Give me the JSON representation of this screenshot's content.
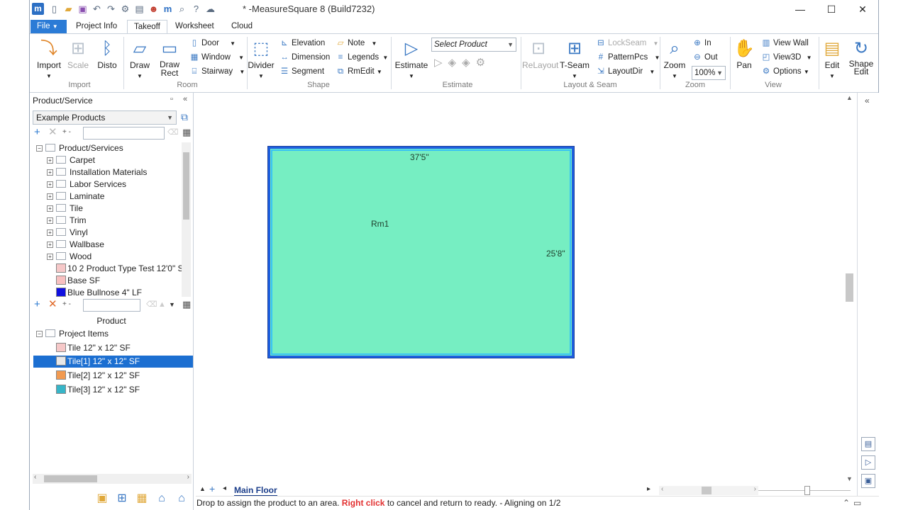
{
  "window": {
    "title": "* -MeasureSquare 8 (Build7232)",
    "logo": "m",
    "controls": [
      "—",
      "☐",
      "✕"
    ]
  },
  "quick_access": [
    "new-doc-icon",
    "open-folder-icon",
    "save-icon",
    "undo-icon",
    "redo-icon",
    "settings-icon",
    "template-icon",
    "person-icon",
    "m-logo-icon",
    "print-preview-icon",
    "help-icon",
    "cloud-icon"
  ],
  "tabs": {
    "file": "File",
    "items": [
      "Project Info",
      "Takeoff",
      "Worksheet",
      "Cloud"
    ],
    "active": "Takeoff"
  },
  "ribbon": {
    "import": {
      "label": "Import",
      "group": "Import"
    },
    "scale": {
      "label": "Scale"
    },
    "disto": {
      "label": "Disto"
    },
    "draw": {
      "label": "Draw"
    },
    "draw_rect": {
      "label": "Draw\nRect"
    },
    "door": "Door",
    "window": "Window",
    "stairway": "Stairway",
    "room_group": "Room",
    "divider": "Divider",
    "elevation": "Elevation",
    "dimension": "Dimension",
    "segment": "Segment",
    "note": "Note",
    "legends": "Legends",
    "rmedit": "RmEdit",
    "shape_group": "Shape",
    "estimate": "Estimate",
    "select_product": "Select Product",
    "estimate_group": "Estimate",
    "relayout": "ReLayout",
    "tseam": "T-Seam",
    "lockseam": "LockSeam",
    "patternpcs": "PatternPcs",
    "layoutdir": "LayoutDir",
    "layout_group": "Layout & Seam",
    "zoom": "Zoom",
    "zoom_in": "In",
    "zoom_out": "Out",
    "zoom_level": "100%",
    "zoom_group": "Zoom",
    "pan": "Pan",
    "view_wall": "View Wall",
    "view3d": "View3D",
    "options": "Options",
    "view_group": "View",
    "edit": "Edit",
    "shape_edit": "Shape\nEdit"
  },
  "left_panel": {
    "title": "Product/Service",
    "catalog": "Example Products",
    "tree_root": "Product/Services",
    "categories": [
      "Carpet",
      "Installation Materials",
      "Labor Services",
      "Laminate",
      "Tile",
      "Trim",
      "Vinyl",
      "Wallbase",
      "Wood"
    ],
    "products": [
      {
        "label": "10 2 Product Type Test 12'0\" SY",
        "color": "#f6c8c8"
      },
      {
        "label": "Base  SF",
        "color": "#f8c0c0"
      },
      {
        "label": "Blue Bullnose 4\" LF",
        "color": "#1010e0"
      }
    ],
    "column_header": "Product",
    "project_root": "Project Items",
    "project_items": [
      {
        "label": "Tile 12\" x 12\" SF",
        "color": "#f6c8c8",
        "selected": false
      },
      {
        "label": "Tile[1] 12\" x 12\" SF",
        "color": "#e8e8e8",
        "selected": true
      },
      {
        "label": "Tile[2] 12\" x 12\" SF",
        "color": "#f29a50",
        "selected": false
      },
      {
        "label": "Tile[3] 12\" x 12\" SF",
        "color": "#37b5c8",
        "selected": false
      }
    ]
  },
  "canvas": {
    "room_name": "Rm1",
    "width_label": "37'5\"",
    "height_label": "25'8\"",
    "room_fill": "#76eec2",
    "room_border": "#1d5fe0"
  },
  "sheet": {
    "tab": "Main Floor"
  },
  "status": {
    "before": "Drop to assign the product to an area. ",
    "highlight": "Right click",
    "after": " to cancel and return to ready. - Aligning on 1/2"
  }
}
